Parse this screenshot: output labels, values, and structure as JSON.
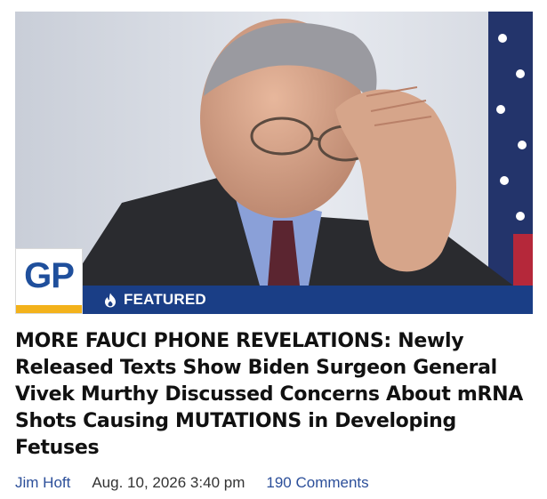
{
  "article": {
    "featured_label": "FEATURED",
    "featured_icon": "flame-icon",
    "logo_text": "GP",
    "headline": "MORE FAUCI PHONE REVELATIONS: Newly Released Texts Show Biden Surgeon General Vivek Murthy Discussed Concerns About mRNA Shots Causing MUTATIONS in Developing Fetuses",
    "author": "Jim Hoft",
    "date": "Aug. 10, 2026 3:40 pm",
    "comments": "190 Comments"
  },
  "colors": {
    "banner": "#1a3e86",
    "logo_blue": "#1f4f9c",
    "logo_gold": "#f3b21b",
    "link": "#2c4f9a"
  }
}
